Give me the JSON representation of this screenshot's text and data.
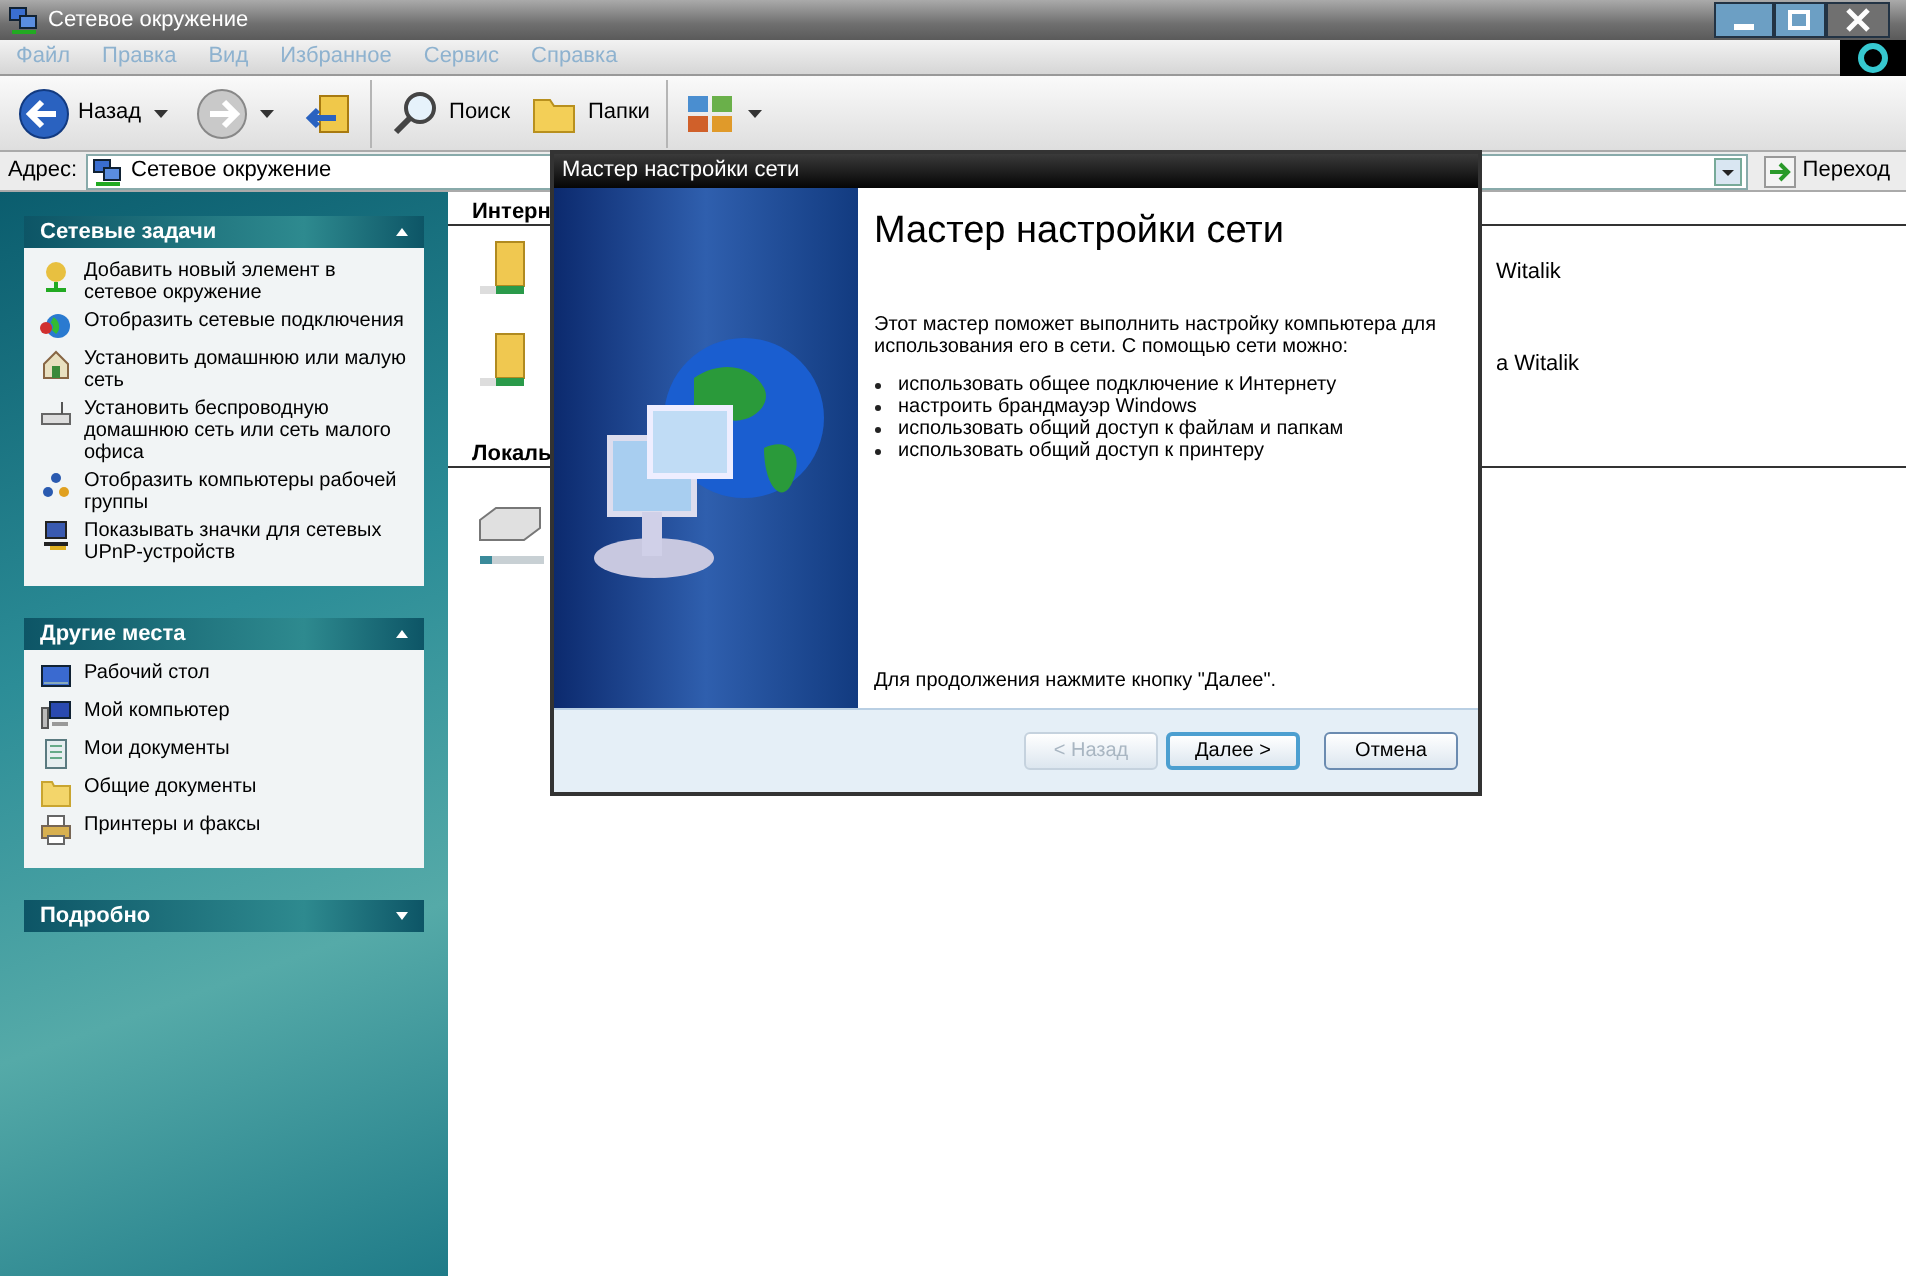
{
  "window": {
    "title": "Сетевое окружение"
  },
  "menu": [
    "Файл",
    "Правка",
    "Вид",
    "Избранное",
    "Сервис",
    "Справка"
  ],
  "toolbar": [
    {
      "kind": "back",
      "label": "Назад",
      "dropdown": true
    },
    {
      "kind": "forward",
      "dropdown": true
    },
    {
      "kind": "up"
    },
    {
      "kind": "search",
      "label": "Поиск"
    },
    {
      "kind": "folders",
      "label": "Папки"
    },
    {
      "kind": "views",
      "dropdown": true
    }
  ],
  "address": {
    "label": "Адрес:",
    "value": "Сетевое окружение",
    "go": "Переход"
  },
  "sidebar": [
    {
      "title": "Сетевые задачи",
      "expanded": true,
      "items": [
        {
          "kind": "add",
          "label": "Добавить новый элемент в сетевое окружение"
        },
        {
          "kind": "connections",
          "label": "Отобразить сетевые подключения"
        },
        {
          "kind": "home",
          "label": "Установить домашнюю или малую сеть"
        },
        {
          "kind": "wireless",
          "label": "Установить беспроводную домашнюю сеть или сеть малого офиса"
        },
        {
          "kind": "workgroup",
          "label": "Отобразить компьютеры рабочей группы"
        },
        {
          "kind": "upnp",
          "label": "Показывать значки для сетевых UPnP-устройств"
        }
      ]
    },
    {
      "title": "Другие места",
      "expanded": true,
      "items": [
        {
          "kind": "desktop",
          "label": "Рабочий стол"
        },
        {
          "kind": "computer",
          "label": "Мой компьютер"
        },
        {
          "kind": "documents",
          "label": "Мои документы"
        },
        {
          "kind": "folder",
          "label": "Общие документы"
        },
        {
          "kind": "printer",
          "label": "Принтеры и факсы"
        }
      ]
    },
    {
      "title": "Подробно",
      "expanded": false
    }
  ],
  "groups": [
    {
      "heading": "Интерн",
      "items": [
        {
          "kind": "share",
          "label": "Witalik"
        },
        {
          "kind": "share",
          "label": "a Witalik"
        }
      ]
    },
    {
      "heading": "Локаль",
      "items": [
        {
          "kind": "drive"
        }
      ]
    }
  ],
  "dialog": {
    "title": "Мастер настройки сети",
    "heading": "Мастер настройки сети",
    "intro": "Этот мастер поможет выполнить настройку компьютера для использования его в сети. С помощью сети можно:",
    "bullets": [
      "использовать общее подключение к Интернету",
      "настроить брандмауэр Windows",
      "использовать общий доступ к файлам и папкам",
      "использовать общий доступ к принтеру"
    ],
    "footer_text": "Для продолжения нажмите кнопку \"Далее\".",
    "buttons": [
      {
        "label": "< Назад",
        "disabled": true,
        "default": false
      },
      {
        "label": "Далее >",
        "disabled": false,
        "default": true
      },
      {
        "label": "Отмена",
        "disabled": false,
        "default": false
      }
    ]
  }
}
